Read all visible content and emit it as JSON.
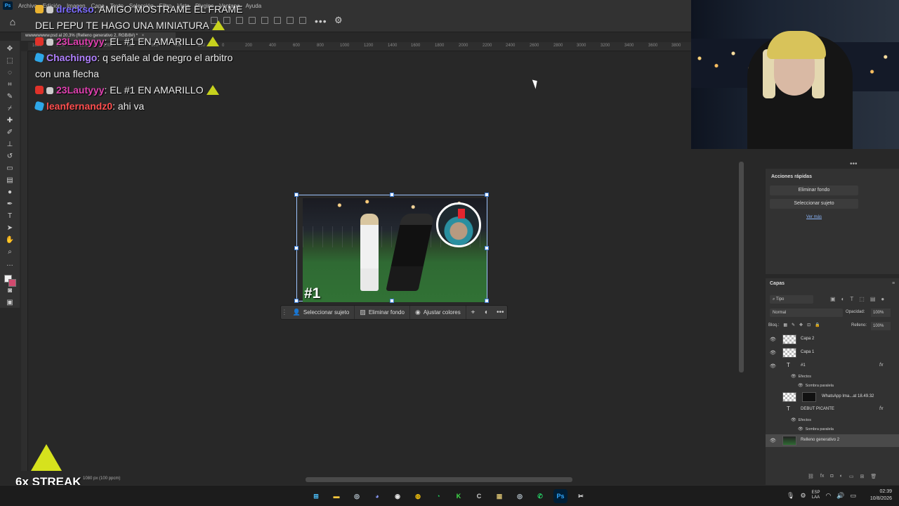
{
  "app": {
    "menu": [
      "Archivo",
      "Edición",
      "Imagen",
      "Capa",
      "Texto",
      "Selección",
      "Filtro",
      "Vista",
      "Plugins",
      "Ventana",
      "Ayuda"
    ],
    "ps_logo": "Ps",
    "doc_tab": "wwwwwwww.psd al 20,3% (Relleno generativo 2, RGB/8#) *",
    "doc_close": "×",
    "ruler_ticks": [
      "1600",
      "1400",
      "1200",
      "1000",
      "800",
      "600",
      "400",
      "200",
      "0",
      "200",
      "400",
      "600",
      "800",
      "1000",
      "1200",
      "1400",
      "1600",
      "1800",
      "2000",
      "2200",
      "2400",
      "2600",
      "2800",
      "3000",
      "3200",
      "3400",
      "3600",
      "3800"
    ]
  },
  "chat": {
    "messages": [
      {
        "user": "dreckso",
        "user_color": "#7c6cff",
        "badge": "gold",
        "text": ": AMIGO MOSTRAME EL FRAME"
      },
      {
        "user": "",
        "user_color": "#ececec",
        "badge": "",
        "text": "DEL PEPU TE HAGO UNA MINIATURA"
      },
      {
        "user": "23Lautyyy",
        "user_color": "#e040b0",
        "badge": "red",
        "text": ": EL #1 EN AMARILLO"
      },
      {
        "user": "Chachingo",
        "user_color": "#b080ff",
        "badge": "blue",
        "text": ": q señale al de negro el arbitro"
      },
      {
        "user": "",
        "user_color": "#ececec",
        "badge": "",
        "text": "con una flecha"
      },
      {
        "user": "23Lautyyy",
        "user_color": "#e040b0",
        "badge": "red",
        "text": ": EL #1 EN AMARILLO"
      },
      {
        "user": "leanfernandz0",
        "user_color": "#ff4f4f",
        "badge": "blue",
        "text": ": ahi va"
      }
    ]
  },
  "canvas": {
    "image_label": "#1"
  },
  "context_bar": {
    "select_subject": "Seleccionar sujeto",
    "remove_bg": "Eliminar fondo",
    "adjust_colors": "Ajustar colores",
    "more": "•••"
  },
  "status": {
    "zoom_info": "1080 px (100 ppcm)"
  },
  "streak": {
    "label": "6x STREAK"
  },
  "quick_actions": {
    "title": "Acciones rápidas",
    "remove_bg": "Eliminar fondo",
    "select_subject": "Seleccionar sujeto",
    "see_more": "Ver más",
    "ellipsis": "•••"
  },
  "layers_panel": {
    "title": "Capas",
    "search": "Tipo",
    "blend_mode": "Normal",
    "opacity_label": "Opacidad:",
    "opacity": "100%",
    "lock_label": "Bloq.:",
    "fill_label": "Relleno:",
    "fill": "100%",
    "layers": [
      {
        "name": "Capa 2",
        "kind": "pixel",
        "visible": true
      },
      {
        "name": "Capa 1",
        "kind": "pixel",
        "visible": true
      },
      {
        "name": "#1",
        "kind": "text",
        "visible": true,
        "fx": "fx"
      },
      {
        "name": "WhatsApp Ima...at 18.49.32",
        "kind": "smart",
        "visible": false
      },
      {
        "name": "DEBUT PICANTE",
        "kind": "text",
        "visible": false,
        "fx": "fx"
      },
      {
        "name": "Relleno generativo 2",
        "kind": "photo",
        "visible": true,
        "selected": true
      }
    ],
    "effects_label": "Efectos",
    "drop_shadow": "Sombra paralela"
  },
  "windows": {
    "lang_top": "ESP",
    "lang_bottom": "LAA",
    "time": "02:39",
    "date": "10/8/2026"
  }
}
